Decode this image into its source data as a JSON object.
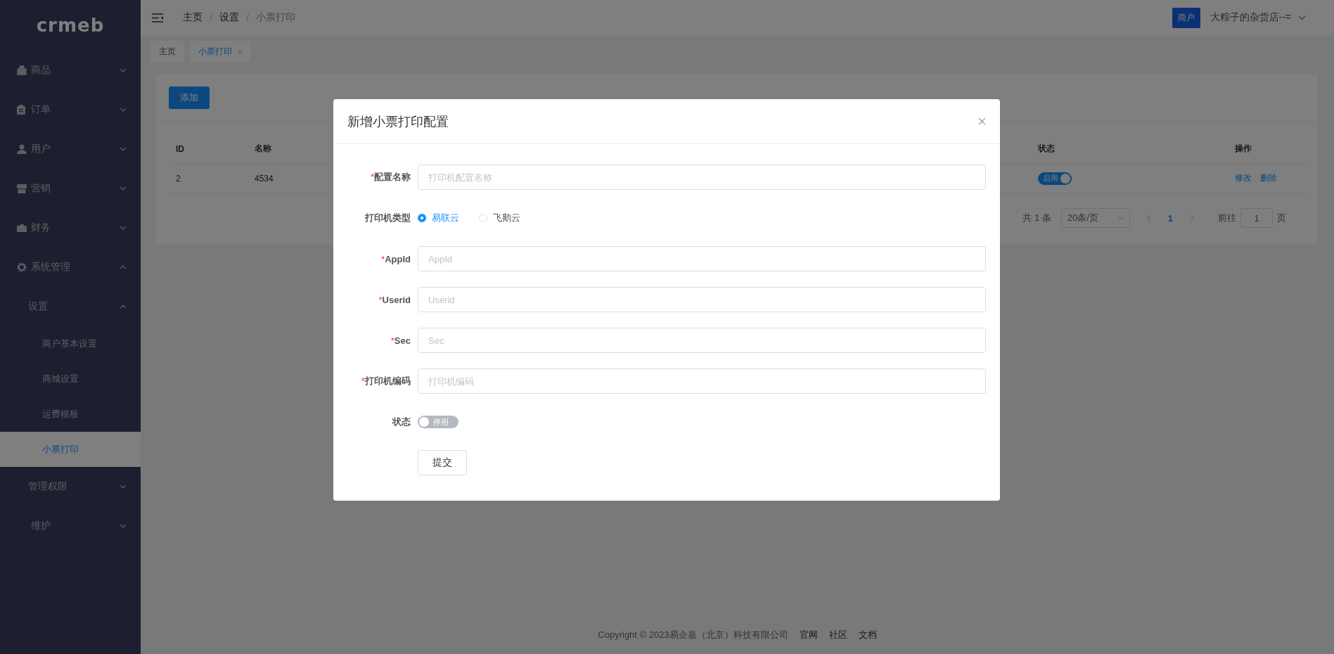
{
  "logo": "crmeb",
  "sidebar": {
    "items": [
      {
        "label": "商品",
        "expanded": false,
        "selected": false
      },
      {
        "label": "订单",
        "expanded": false,
        "selected": false
      },
      {
        "label": "用户",
        "expanded": false,
        "selected": false
      },
      {
        "label": "营销",
        "expanded": false,
        "selected": false
      },
      {
        "label": "财务",
        "expanded": false,
        "selected": false
      },
      {
        "label": "系统管理",
        "expanded": true,
        "selected": false,
        "children": [
          {
            "label": "设置",
            "expanded": true,
            "selected": false,
            "children": [
              {
                "label": "商户基本设置",
                "selected": false
              },
              {
                "label": "商城设置",
                "selected": false
              },
              {
                "label": "运费模板",
                "selected": false
              },
              {
                "label": "小票打印",
                "selected": true
              }
            ]
          },
          {
            "label": "管理权限",
            "expanded": false,
            "selected": false
          }
        ]
      },
      {
        "label": "维护",
        "expanded": false,
        "selected": false
      }
    ]
  },
  "header": {
    "breadcrumb": [
      "主页",
      "设置",
      "小票打印"
    ],
    "breadcrumb_separator": "/",
    "role_badge": "商户",
    "user_name": "大粽子的杂货店--="
  },
  "tabs": [
    {
      "label": "主页",
      "selected": false,
      "closable": false
    },
    {
      "label": "小票打印",
      "selected": true,
      "closable": true
    }
  ],
  "card": {
    "add_button": "添加",
    "table": {
      "columns": [
        "ID",
        "名称",
        "状态",
        "操作"
      ],
      "rows": [
        {
          "id": "2",
          "name": "4534",
          "status": {
            "on": true,
            "label": "启用"
          },
          "actions": [
            "修改",
            "删除"
          ]
        }
      ]
    },
    "pagination": {
      "total": "共 1 条",
      "page_size": "20条/页",
      "pages": [
        {
          "label": "1",
          "selected": true
        }
      ],
      "goto_label": "前往",
      "goto_value": "1",
      "goto_suffix": "页"
    }
  },
  "modal": {
    "title": "新增小票打印配置",
    "required_mark": "*",
    "fields": [
      {
        "kind": "text",
        "label": "配置名称",
        "required": true,
        "placeholder": "打印机配置名称"
      },
      {
        "kind": "radio",
        "label": "打印机类型",
        "required": false,
        "options": [
          {
            "label": "易联云",
            "selected": true
          },
          {
            "label": "飞鹅云",
            "selected": false
          }
        ]
      },
      {
        "kind": "text",
        "label": "AppId",
        "required": true,
        "placeholder": "AppId"
      },
      {
        "kind": "text",
        "label": "Userid",
        "required": true,
        "placeholder": "Userid"
      },
      {
        "kind": "text",
        "label": "Sec",
        "required": true,
        "placeholder": "Sec"
      },
      {
        "kind": "text",
        "label": "打印机编码",
        "required": true,
        "placeholder": "打印机编码"
      },
      {
        "kind": "switch",
        "label": "状态",
        "required": false,
        "on": false,
        "text": "停用"
      }
    ],
    "submit": "提交"
  },
  "footer": {
    "copyright": "Copyright © 2023易企嘉（北京）科技有限公司",
    "links": [
      "官网",
      "社区",
      "文档"
    ]
  }
}
